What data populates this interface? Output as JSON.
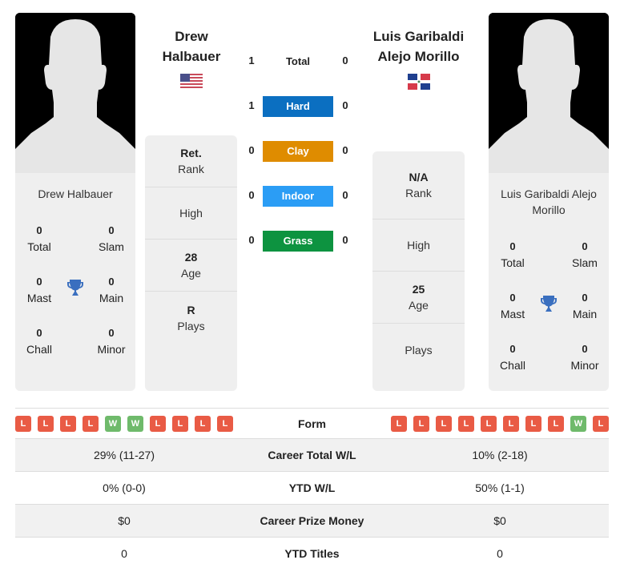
{
  "colors": {
    "hard": "#0b6fc1",
    "clay": "#df8c00",
    "indoor": "#2b9df5",
    "grass": "#0d9340",
    "loss": "#e95b45",
    "win": "#6fba6b",
    "trophy": "#3a6fbf"
  },
  "player1": {
    "header_name_line1": "Drew",
    "header_name_line2": "Halbauer",
    "flag": "usa-flag-icon",
    "card_name": "Drew Halbauer",
    "titles": {
      "total": {
        "value": "0",
        "label": "Total"
      },
      "slam": {
        "value": "0",
        "label": "Slam"
      },
      "mast": {
        "value": "0",
        "label": "Mast"
      },
      "main": {
        "value": "0",
        "label": "Main"
      },
      "chall": {
        "value": "0",
        "label": "Chall"
      },
      "minor": {
        "value": "0",
        "label": "Minor"
      }
    },
    "info": {
      "rank_value": "Ret.",
      "rank_label": "Rank",
      "high_label": "High",
      "age_value": "28",
      "age_label": "Age",
      "plays_value": "R",
      "plays_label": "Plays"
    },
    "form": [
      "L",
      "L",
      "L",
      "L",
      "W",
      "W",
      "L",
      "L",
      "L",
      "L"
    ]
  },
  "player2": {
    "header_name_line1": "Luis Garibaldi",
    "header_name_line2": "Alejo Morillo",
    "flag": "dominican-republic-flag-icon",
    "card_name_line1": "Luis Garibaldi Alejo",
    "card_name_line2": "Morillo",
    "titles": {
      "total": {
        "value": "0",
        "label": "Total"
      },
      "slam": {
        "value": "0",
        "label": "Slam"
      },
      "mast": {
        "value": "0",
        "label": "Mast"
      },
      "main": {
        "value": "0",
        "label": "Main"
      },
      "chall": {
        "value": "0",
        "label": "Chall"
      },
      "minor": {
        "value": "0",
        "label": "Minor"
      }
    },
    "info": {
      "rank_value": "N/A",
      "rank_label": "Rank",
      "high_label": "High",
      "age_value": "25",
      "age_label": "Age",
      "plays_label": "Plays"
    },
    "form": [
      "L",
      "L",
      "L",
      "L",
      "L",
      "L",
      "L",
      "L",
      "W",
      "L"
    ]
  },
  "h2h": [
    {
      "label": "Total",
      "p1": "1",
      "p2": "0"
    },
    {
      "label": "Hard",
      "p1": "1",
      "p2": "0"
    },
    {
      "label": "Clay",
      "p1": "0",
      "p2": "0"
    },
    {
      "label": "Indoor",
      "p1": "0",
      "p2": "0"
    },
    {
      "label": "Grass",
      "p1": "0",
      "p2": "0"
    }
  ],
  "stats": {
    "form_label": "Form",
    "rows": [
      {
        "label": "Career Total W/L",
        "p1": "29% (11-27)",
        "p2": "10% (2-18)"
      },
      {
        "label": "YTD W/L",
        "p1": "0% (0-0)",
        "p2": "50% (1-1)"
      },
      {
        "label": "Career Prize Money",
        "p1": "$0",
        "p2": "$0"
      },
      {
        "label": "YTD Titles",
        "p1": "0",
        "p2": "0"
      }
    ]
  }
}
